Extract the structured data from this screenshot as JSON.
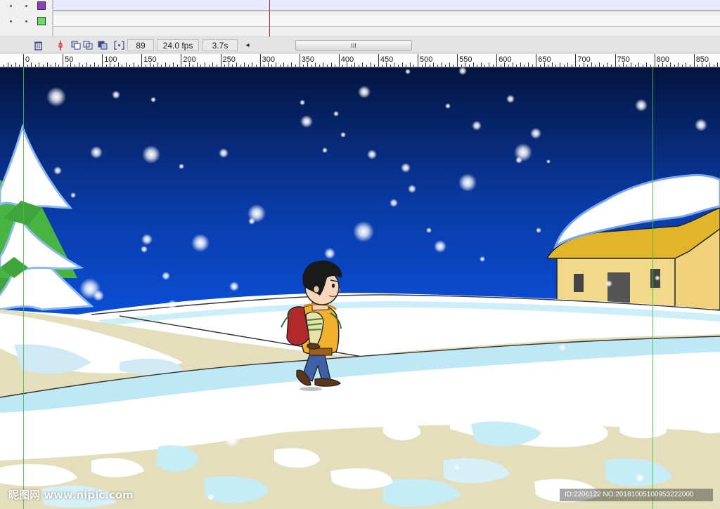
{
  "timeline": {
    "layers": [
      {
        "color": "#8e3ec4"
      },
      {
        "color": "#66dd66"
      }
    ]
  },
  "statusbar": {
    "trash_icon": "trash-icon",
    "frame_number": "89",
    "fps": "24.0 fps",
    "elapsed_time": "3.7s",
    "scroll_arrow": "◂",
    "scroll_thumb": "III"
  },
  "ruler": {
    "labels": [
      "0",
      "50",
      "100",
      "150",
      "200",
      "250",
      "300",
      "350",
      "400",
      "450",
      "500",
      "550",
      "600",
      "650",
      "700",
      "750",
      "800",
      "850"
    ]
  },
  "watermark": {
    "site": "昵图网 www.nipic.com",
    "id": "ID:2206122 NO:20181005100953222000"
  },
  "colors": {
    "sky_top": "#04143f",
    "sky_bottom": "#0b4fd8",
    "snow": "#ffffff",
    "ice": "#bfe8f6",
    "ground": "#e3dfbd",
    "roof": "#e0b52a",
    "house_wall": "#f2d98a",
    "tree": "#3fa53a",
    "guide": "#46c046",
    "playhead": "#cc2222"
  }
}
